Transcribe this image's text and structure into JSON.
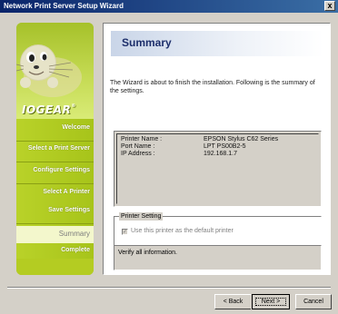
{
  "window": {
    "title": "Network Print Server Setup Wizard",
    "close_label": "x"
  },
  "sidebar": {
    "logo_text": "IOGEAR",
    "registered_mark": "®",
    "items": [
      {
        "label": "Welcome"
      },
      {
        "label": "Select a Print Server"
      },
      {
        "label": "Configure Settings"
      },
      {
        "label": "Select A Printer"
      },
      {
        "label": "Summary"
      },
      {
        "label": "Save Settings"
      },
      {
        "label": "Complete"
      }
    ],
    "active_index": 4
  },
  "summary": {
    "heading": "Summary",
    "intro": "The Wizard is about to finish the installation. Following is the summary of the settings.",
    "settings": [
      {
        "key": "Printer Name :",
        "value": "EPSON Stylus C62 Series"
      },
      {
        "key": "Port Name :",
        "value": "LPT PS00B2-5"
      },
      {
        "key": "IP Address :",
        "value": "192.168.1.7"
      }
    ],
    "printer_setting_legend": "Printer Setting",
    "default_printer_label": "Use this printer as the default printer",
    "default_printer_checked": true,
    "default_printer_check_glyph": "✓",
    "verify_text": "Verify all information."
  },
  "buttons": {
    "back": "< Back",
    "next": "Next >",
    "cancel": "Cancel"
  },
  "colors": {
    "titlebar_start": "#0a246a",
    "titlebar_end": "#3a6ea5",
    "sidebar_green": "#b0c820",
    "heading_blue": "#1c2e6b",
    "dialog_gray": "#d4d0c8"
  }
}
